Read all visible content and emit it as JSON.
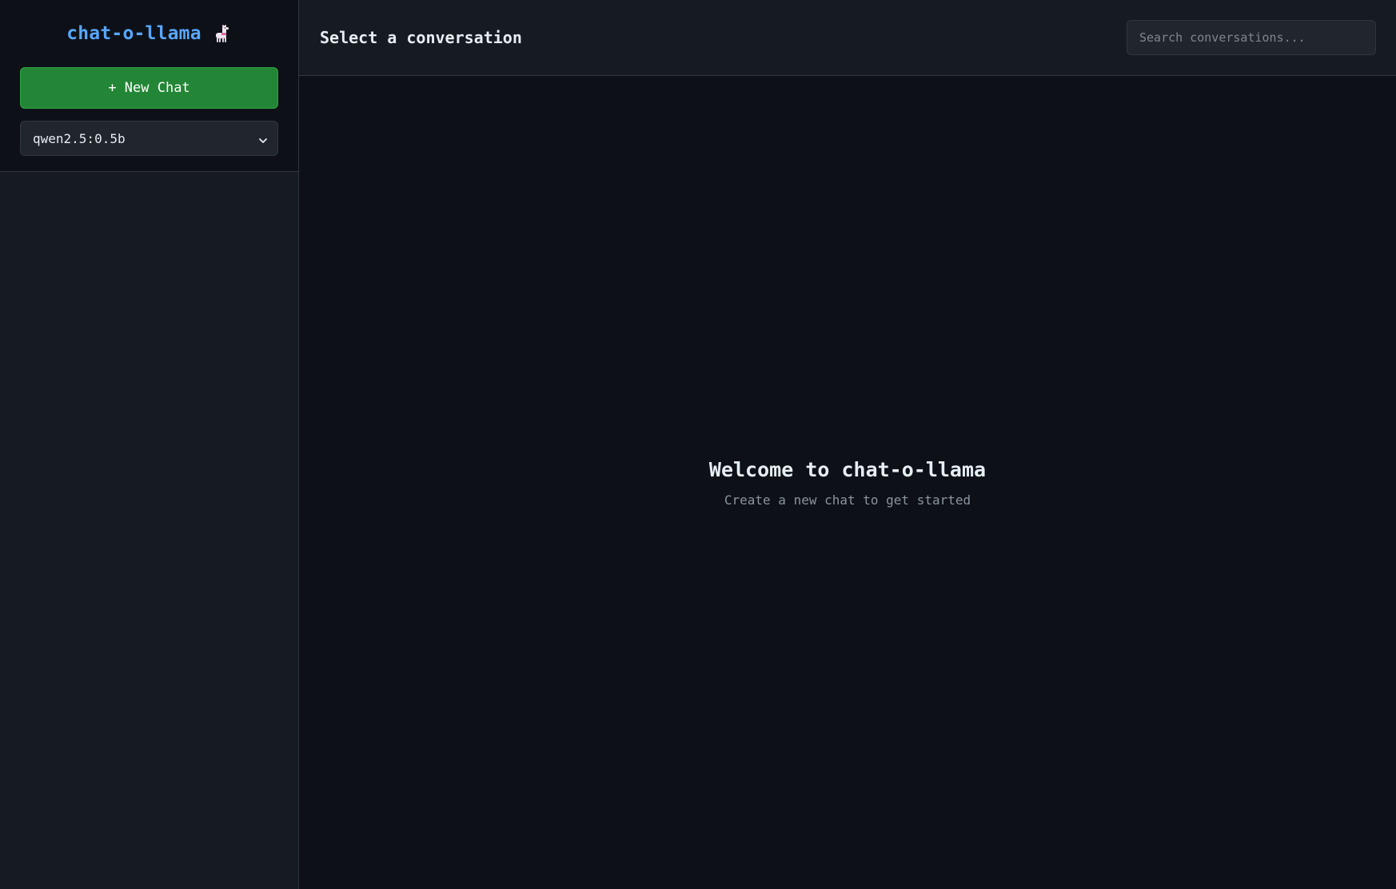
{
  "sidebar": {
    "logo_text": "chat-o-llama",
    "logo_icon": "llama-icon",
    "new_chat_label": "+ New Chat",
    "model_select": {
      "selected": "qwen2.5:0.5b",
      "icon": "chevron-down-icon"
    },
    "conversations": []
  },
  "header": {
    "title": "Select a conversation",
    "search": {
      "placeholder": "Search conversations...",
      "value": ""
    }
  },
  "main": {
    "welcome_title": "Welcome to chat-o-llama",
    "welcome_subtitle": "Create a new chat to get started"
  },
  "colors": {
    "accent": "#58a6ff",
    "primary_button": "#238636",
    "background": "#0d1117",
    "panel": "#161b22",
    "border": "#30363d"
  }
}
